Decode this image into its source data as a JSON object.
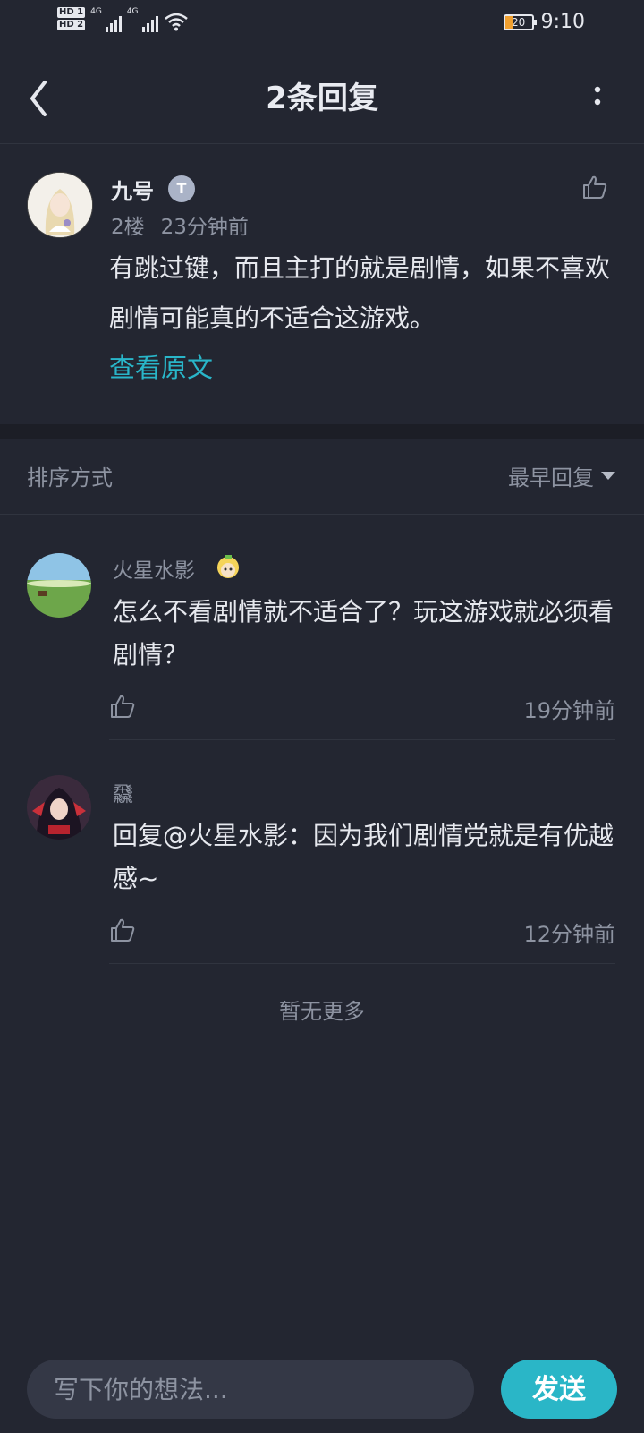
{
  "status_bar": {
    "sim1": "HD 1",
    "sim2": "HD 2",
    "net1": "4G",
    "net2": "4G",
    "battery_level": "20",
    "time": "9:10"
  },
  "header": {
    "title": "2条回复",
    "back_icon": "chevron-left-icon",
    "more_icon": "more-vertical-icon"
  },
  "main_comment": {
    "username": "九号",
    "level_badge": "T",
    "floor": "2楼",
    "time": "23分钟前",
    "text": "有跳过键，而且主打的就是剧情，如果不喜欢剧情可能真的不适合这游戏。",
    "view_original": "查看原文"
  },
  "sort": {
    "label": "排序方式",
    "selected": "最早回复"
  },
  "replies": [
    {
      "username": "火星水影",
      "text": "怎么不看剧情就不适合了？玩这游戏就必须看剧情？",
      "time": "19分钟前"
    },
    {
      "username": "飝",
      "text": "回复@火星水影：因为我们剧情党就是有优越感~",
      "time": "12分钟前"
    }
  ],
  "no_more": "暂无更多",
  "composer": {
    "placeholder": "写下你的想法...",
    "send_label": "发送"
  },
  "colors": {
    "background": "#232631",
    "accent": "#2ab6c7",
    "link": "#29b6c9",
    "muted_text": "#8d93a1"
  }
}
